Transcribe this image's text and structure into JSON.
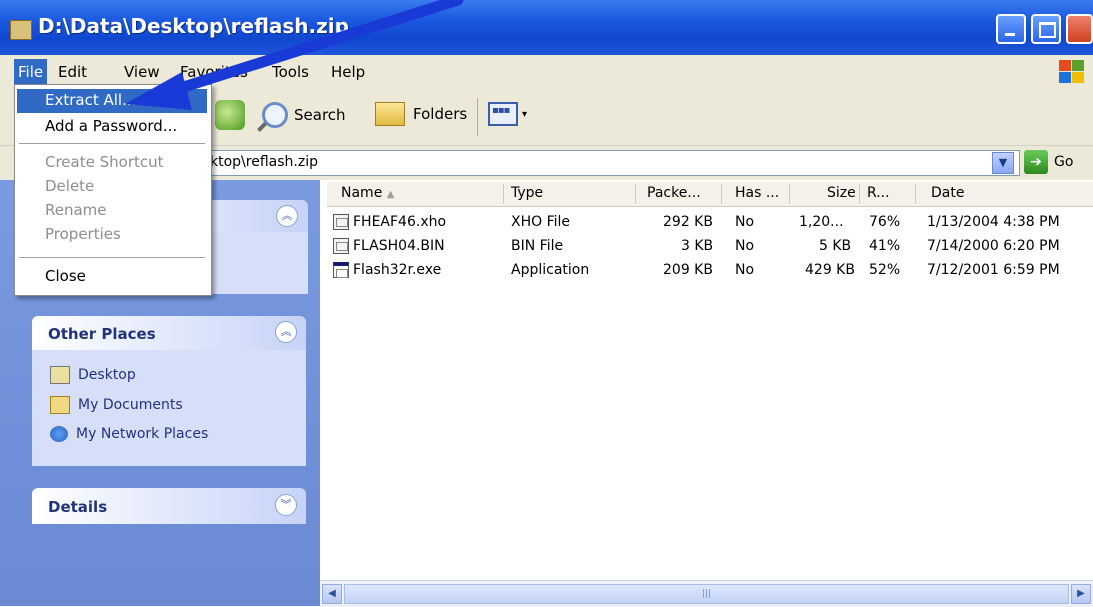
{
  "window": {
    "title": "D:\\Data\\Desktop\\reflash.zip"
  },
  "menubar": {
    "file": "File",
    "edit": "Edit",
    "view": "View",
    "favorites": "Favorites",
    "tools": "Tools",
    "help": "Help"
  },
  "file_menu": {
    "extract_all": "Extract All...",
    "add_password": "Add a Password...",
    "create_shortcut": "Create Shortcut",
    "delete": "Delete",
    "rename": "Rename",
    "properties": "Properties",
    "close": "Close"
  },
  "toolbar": {
    "search": "Search",
    "folders": "Folders"
  },
  "address": {
    "value_visible": "ktop\\reflash.zip",
    "go": "Go"
  },
  "taskpane": {
    "other_places": {
      "title": "Other Places",
      "items": [
        "Desktop",
        "My Documents",
        "My Network Places"
      ]
    },
    "details": {
      "title": "Details"
    }
  },
  "columns": {
    "name": "Name",
    "type": "Type",
    "packed": "Packe...",
    "has": "Has ...",
    "size": "Size",
    "ratio": "R...",
    "date": "Date"
  },
  "files": [
    {
      "name": "FHEAF46.xho",
      "type": "XHO File",
      "packed": "292 KB",
      "has": "No",
      "size": "1,20...",
      "ratio": "76%",
      "date": "1/13/2004 4:38 PM"
    },
    {
      "name": "FLASH04.BIN",
      "type": "BIN File",
      "packed": "3 KB",
      "has": "No",
      "size": "5 KB",
      "ratio": "41%",
      "date": "7/14/2000 6:20 PM"
    },
    {
      "name": "Flash32r.exe",
      "type": "Application",
      "packed": "209 KB",
      "has": "No",
      "size": "429 KB",
      "ratio": "52%",
      "date": "7/12/2001 6:59 PM"
    }
  ],
  "colors": {
    "title_bar": "#0f48cf",
    "highlight": "#316ac5",
    "task_pane": "#7a9be0",
    "arrow": "#1a3ad8"
  },
  "icons": {
    "up": "folder-up-icon",
    "search": "search-icon",
    "folders": "folders-icon",
    "views": "views-icon",
    "go": "go-arrow-icon",
    "windows": "windows-logo-icon"
  }
}
